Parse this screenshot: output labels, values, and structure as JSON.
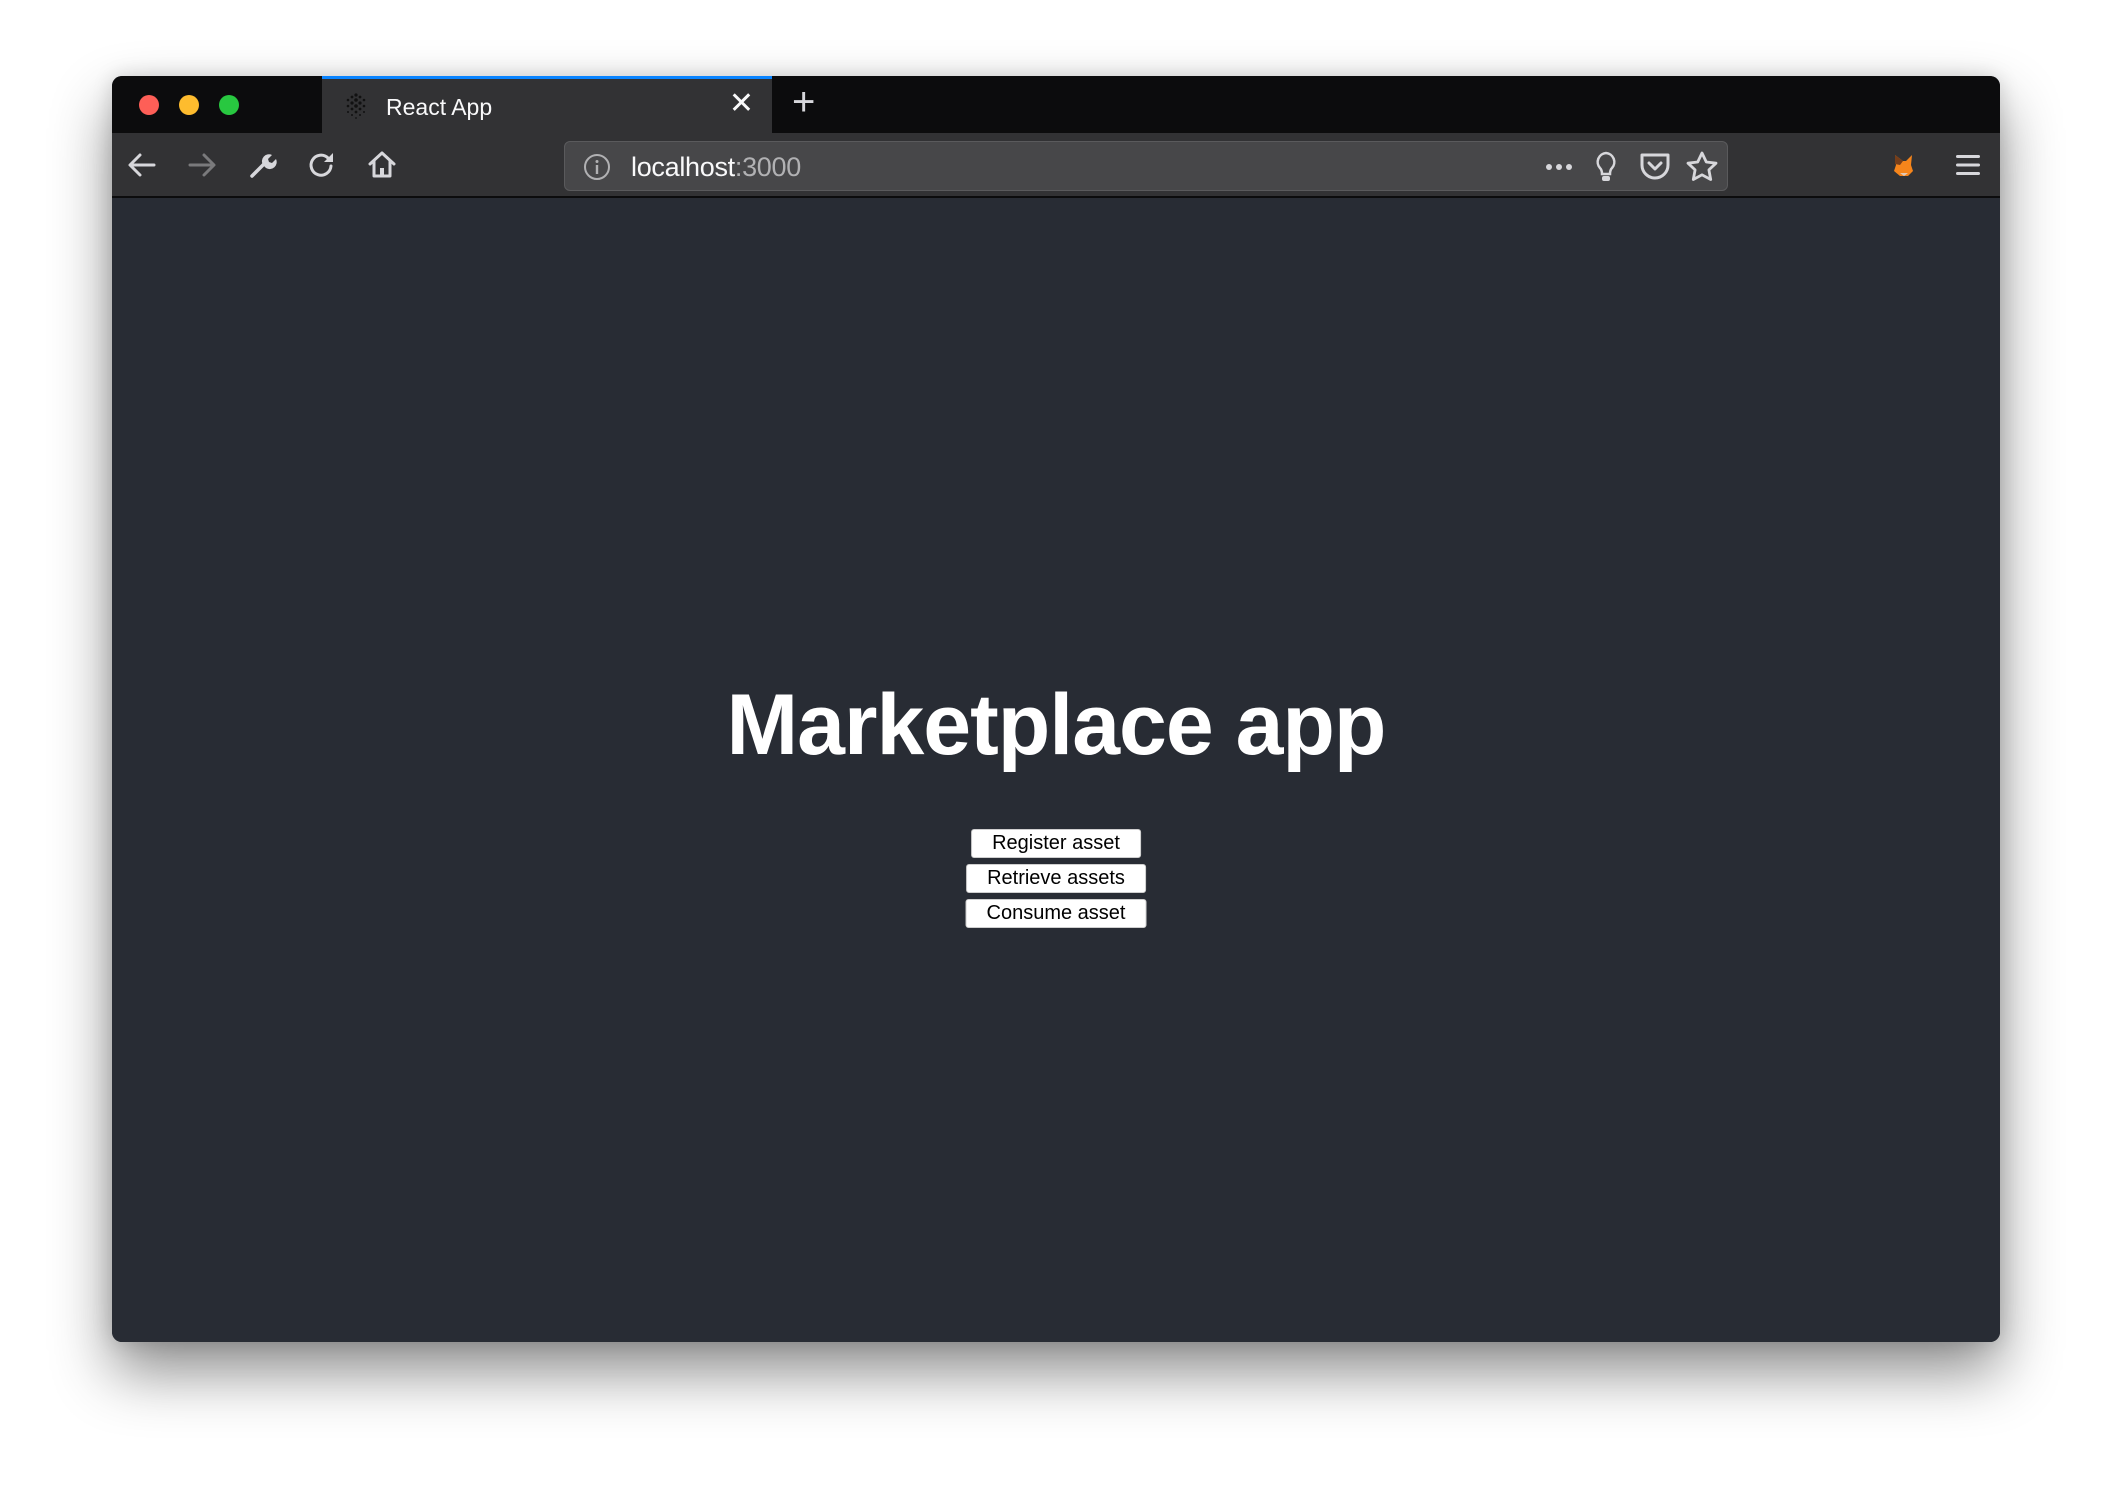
{
  "browser": {
    "tab": {
      "title": "React App",
      "favicon": "react-dots-favicon",
      "close_icon": "close-icon"
    },
    "new_tab_icon": "plus-icon",
    "nav": {
      "back_icon": "arrow-left-icon",
      "forward_icon": "arrow-right-icon",
      "devtools_icon": "wrench-icon",
      "reload_icon": "reload-icon",
      "home_icon": "home-icon"
    },
    "url": {
      "host": "localhost",
      "port": ":3000",
      "info_icon": "info-icon"
    },
    "url_actions": [
      "more-icon",
      "lightbulb-icon",
      "pocket-icon",
      "star-icon"
    ],
    "extensions": [
      "metamask-fox-icon"
    ],
    "menu_icon": "hamburger-menu-icon",
    "accent_color": "#0a84ff"
  },
  "page": {
    "title": "Marketplace app",
    "buttons": [
      {
        "label": "Register asset"
      },
      {
        "label": "Retrieve assets"
      },
      {
        "label": "Consume asset"
      }
    ],
    "background_color": "#282c34"
  }
}
